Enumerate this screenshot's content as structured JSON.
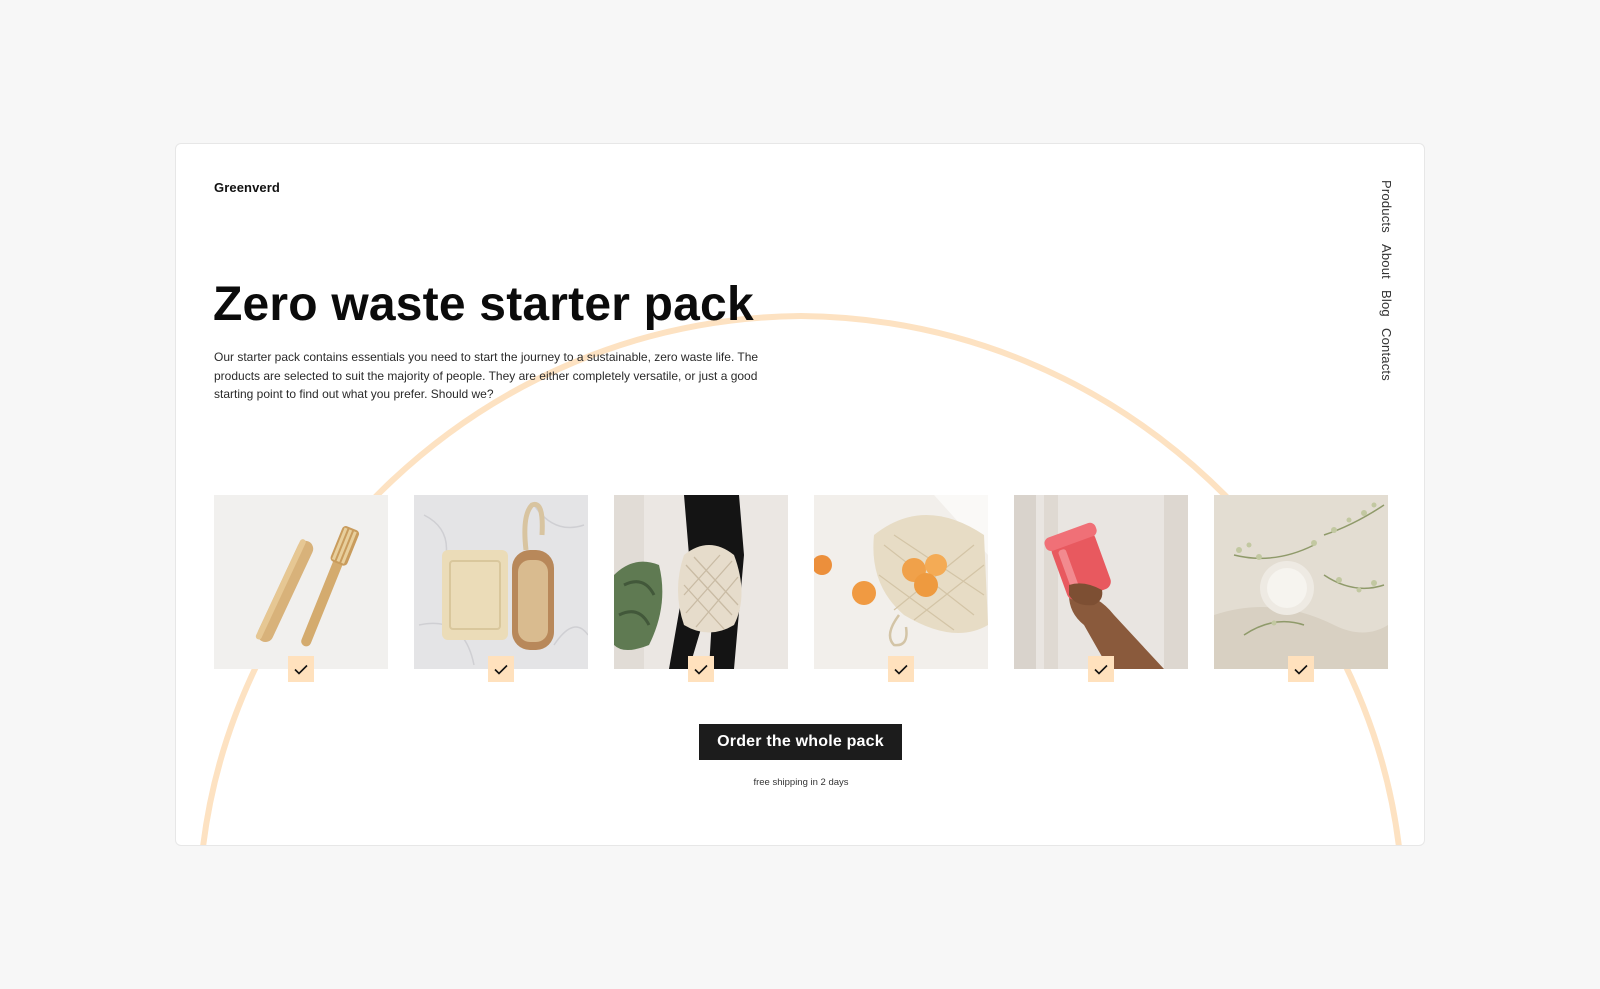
{
  "brand": "Greenverd",
  "nav": [
    "Products",
    "About",
    "Blog",
    "Contacts"
  ],
  "hero": {
    "title": "Zero waste starter pack",
    "description": "Our starter pack contains essentials you need to start the journey to a sustainable, zero waste life. The products are selected to suit the majority of people. They are either completely versatile, or just a good starting point to find out what you prefer. Should we?"
  },
  "products": [
    {
      "image": "bamboo-toothbrush",
      "selected": true
    },
    {
      "image": "soap-and-brush",
      "selected": true
    },
    {
      "image": "mesh-shopping-bag",
      "selected": true
    },
    {
      "image": "produce-bag-with-apricots",
      "selected": true
    },
    {
      "image": "reusable-cup",
      "selected": true
    },
    {
      "image": "solid-deodorant-with-flowers",
      "selected": true
    }
  ],
  "cta": {
    "label": "Order the whole pack",
    "note": "free shipping in 2 days"
  },
  "colors": {
    "accent": "#ffe1bd",
    "arc": "#fde2c2",
    "button": "#1c1c1c",
    "background": "#f7f7f7"
  }
}
